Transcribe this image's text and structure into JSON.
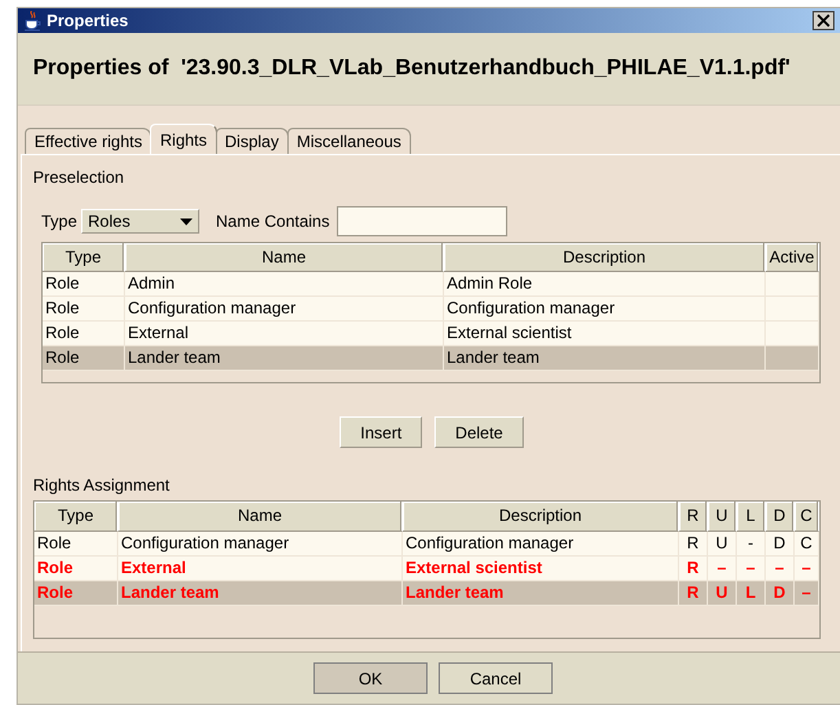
{
  "window": {
    "title": "Properties"
  },
  "heading": "Properties of  '23.90.3_DLR_VLab_Benutzerhandbuch_PHILAE_V1.1.pdf'",
  "tabs": [
    {
      "label": "Effective rights",
      "selected": false
    },
    {
      "label": "Rights",
      "selected": true
    },
    {
      "label": "Display",
      "selected": false
    },
    {
      "label": "Miscellaneous",
      "selected": false
    }
  ],
  "preselection": {
    "label": "Preselection",
    "type_label": "Type",
    "type_value": "Roles",
    "name_label": "Name Contains",
    "columns": [
      "Type",
      "Name",
      "Description",
      "Active"
    ],
    "rows": [
      {
        "cells": [
          "Role",
          "Admin",
          "Admin Role",
          ""
        ],
        "selected": false
      },
      {
        "cells": [
          "Role",
          "Configuration manager",
          "Configuration manager",
          ""
        ],
        "selected": false
      },
      {
        "cells": [
          "Role",
          "External",
          "External scientist",
          ""
        ],
        "selected": false
      },
      {
        "cells": [
          "Role",
          "Lander team",
          "Lander team",
          ""
        ],
        "selected": true
      }
    ]
  },
  "actions": [
    "Insert",
    "Delete"
  ],
  "rights_assignment": {
    "label": "Rights Assignment",
    "columns": [
      "Type",
      "Name",
      "Description",
      "R",
      "U",
      "L",
      "D",
      "C"
    ],
    "rows": [
      {
        "cells": [
          "Role",
          "Configuration manager",
          "Configuration manager",
          "R",
          "U",
          "-",
          "D",
          "C"
        ],
        "highlighted": false,
        "selected": false
      },
      {
        "cells": [
          "Role",
          "External",
          "External scientist",
          "R",
          "–",
          "–",
          "–",
          "–"
        ],
        "highlighted": true,
        "selected": false
      },
      {
        "cells": [
          "Role",
          "Lander team",
          "Lander team",
          "R",
          "U",
          "L",
          "D",
          "–"
        ],
        "highlighted": true,
        "selected": true
      }
    ]
  },
  "buttons": [
    "OK",
    "Cancel"
  ]
}
